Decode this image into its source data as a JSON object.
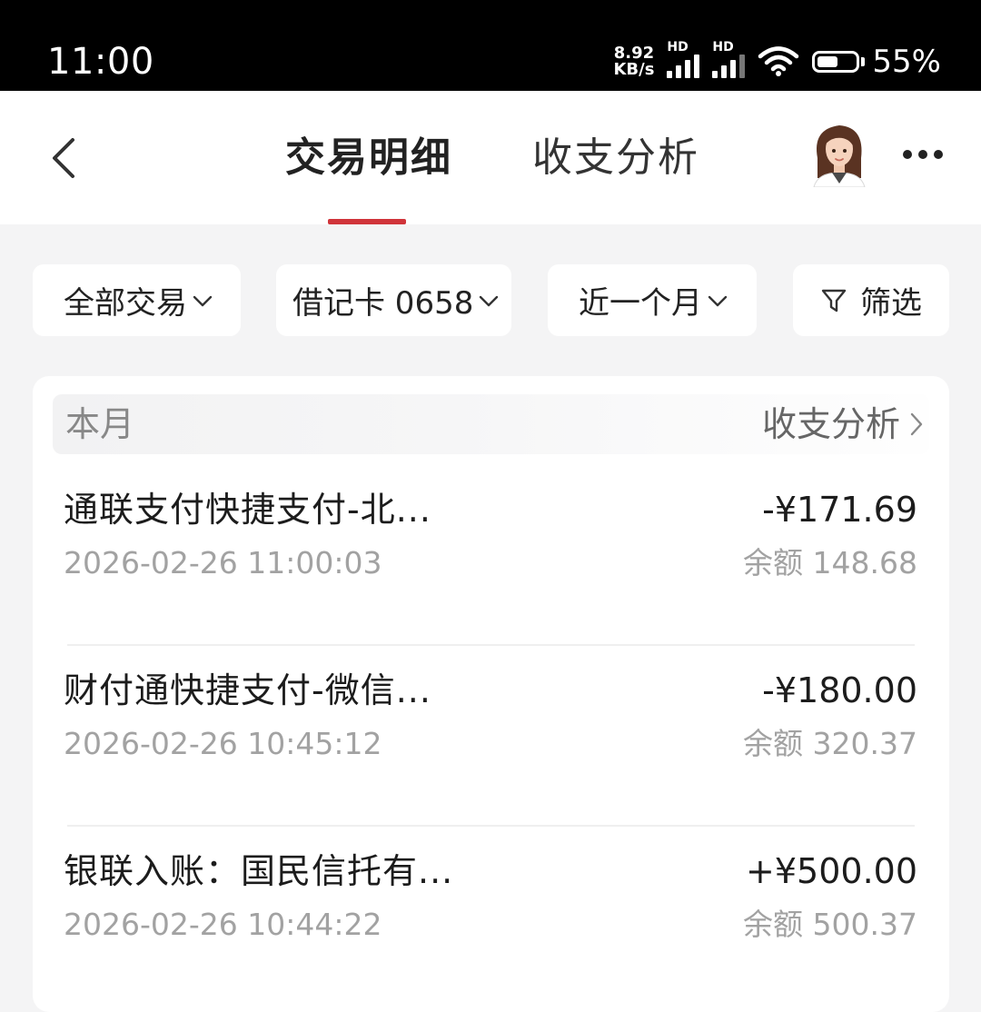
{
  "status_bar": {
    "time": "11:00",
    "net_speed_value": "8.92",
    "net_speed_unit": "KB/s",
    "sim1_label": "HD",
    "sim2_label": "HD",
    "battery_percent": "55%",
    "battery_level": 0.55
  },
  "header": {
    "tabs": [
      {
        "label": "交易明细",
        "active": true
      },
      {
        "label": "收支分析",
        "active": false
      }
    ],
    "accent_color": "#d0343a"
  },
  "filters": [
    {
      "label": "全部交易"
    },
    {
      "label": "借记卡 0658"
    },
    {
      "label": "近一个月"
    },
    {
      "label": "筛选"
    }
  ],
  "month_section": {
    "label": "本月",
    "analysis_link": "收支分析"
  },
  "transactions": [
    {
      "name": "通联支付快捷支付-北...",
      "time": "2026-02-26 11:00:03",
      "amount": "-¥171.69",
      "balance": "余额 148.68"
    },
    {
      "name": "财付通快捷支付-微信...",
      "time": "2026-02-26 10:45:12",
      "amount": "-¥180.00",
      "balance": "余额 320.37"
    },
    {
      "name": "银联入账：国民信托有...",
      "time": "2026-02-26 10:44:22",
      "amount": "+¥500.00",
      "balance": "余额 500.37"
    }
  ]
}
